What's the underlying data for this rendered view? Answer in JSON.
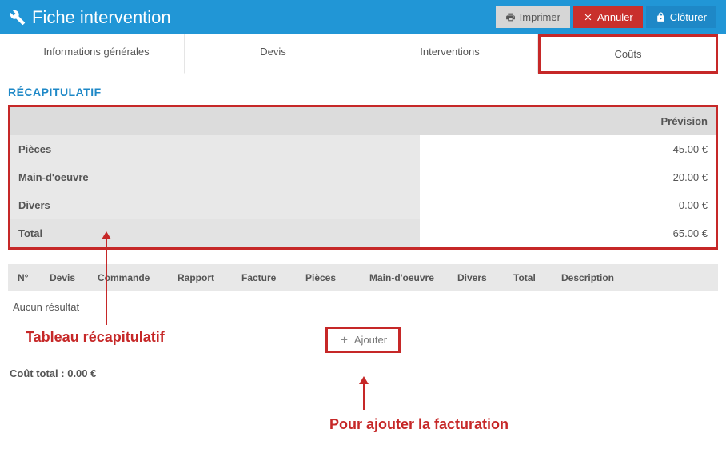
{
  "header": {
    "title": "Fiche intervention",
    "print": "Imprimer",
    "cancel": "Annuler",
    "close": "Clôturer"
  },
  "tabs": [
    "Informations générales",
    "Devis",
    "Interventions",
    "Coûts"
  ],
  "activeTab": 3,
  "sectionTitle": "RÉCAPITULATIF",
  "recap": {
    "colHeader": "Prévision",
    "rows": [
      {
        "label": "Pièces",
        "value": "45.00 €"
      },
      {
        "label": "Main-d'oeuvre",
        "value": "20.00 €"
      },
      {
        "label": "Divers",
        "value": "0.00 €"
      },
      {
        "label": "Total",
        "value": "65.00 €"
      }
    ]
  },
  "columns": [
    "N°",
    "Devis",
    "Commande",
    "Rapport",
    "Facture",
    "Pièces",
    "Main-d'oeuvre",
    "Divers",
    "Total",
    "Description"
  ],
  "emptyText": "Aucun résultat",
  "addLabel": "Ajouter",
  "totalCostLabel": "Coût total :",
  "totalCostValue": "0.00 €",
  "annotations": {
    "recap": "Tableau récapitulatif",
    "add": "Pour ajouter la facturation"
  }
}
